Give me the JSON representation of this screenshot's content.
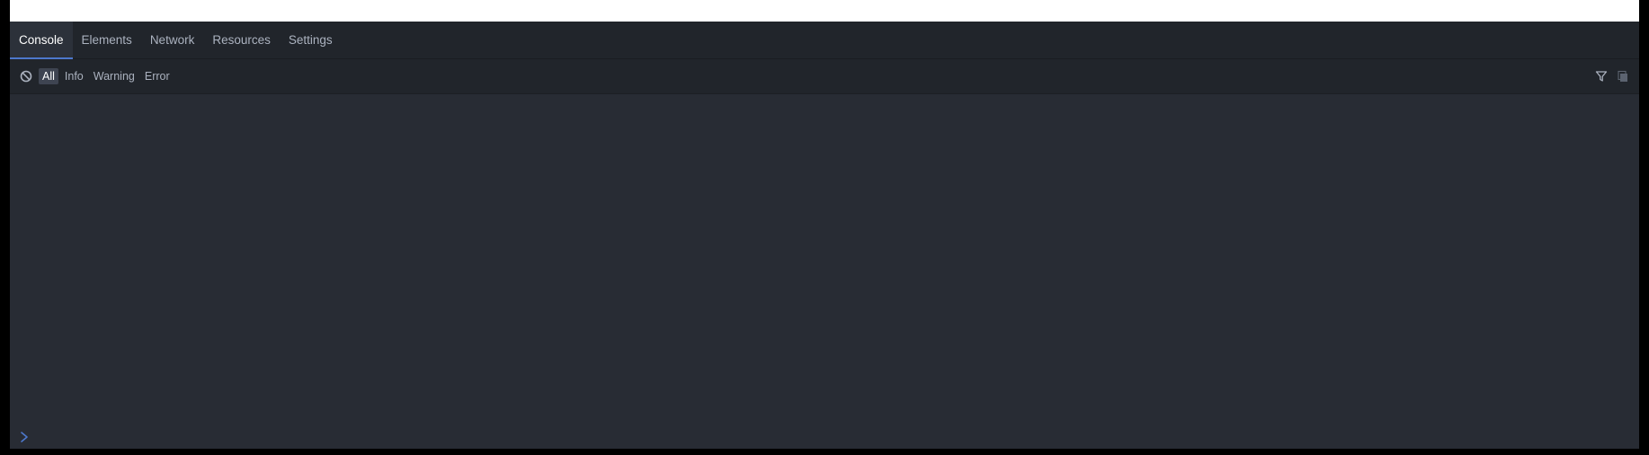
{
  "devtools": {
    "tabs": [
      {
        "label": "Console",
        "active": true
      },
      {
        "label": "Elements",
        "active": false
      },
      {
        "label": "Network",
        "active": false
      },
      {
        "label": "Resources",
        "active": false
      },
      {
        "label": "Settings",
        "active": false
      }
    ],
    "toolbar": {
      "clear_icon": "clear-console-icon",
      "levels": [
        {
          "label": "All",
          "active": true
        },
        {
          "label": "Info",
          "active": false
        },
        {
          "label": "Warning",
          "active": false
        },
        {
          "label": "Error",
          "active": false
        }
      ],
      "right_icons": [
        "filter-icon",
        "copy-icon"
      ]
    },
    "console": {
      "prompt_icon": "chevron-right-icon",
      "input_value": ""
    }
  },
  "colors": {
    "panel_bg": "#282c34",
    "bar_bg": "#21252b",
    "active_tab_bg": "#2c313a",
    "accent": "#4d78cc",
    "text": "#abb2bf",
    "text_active": "#ffffff"
  }
}
